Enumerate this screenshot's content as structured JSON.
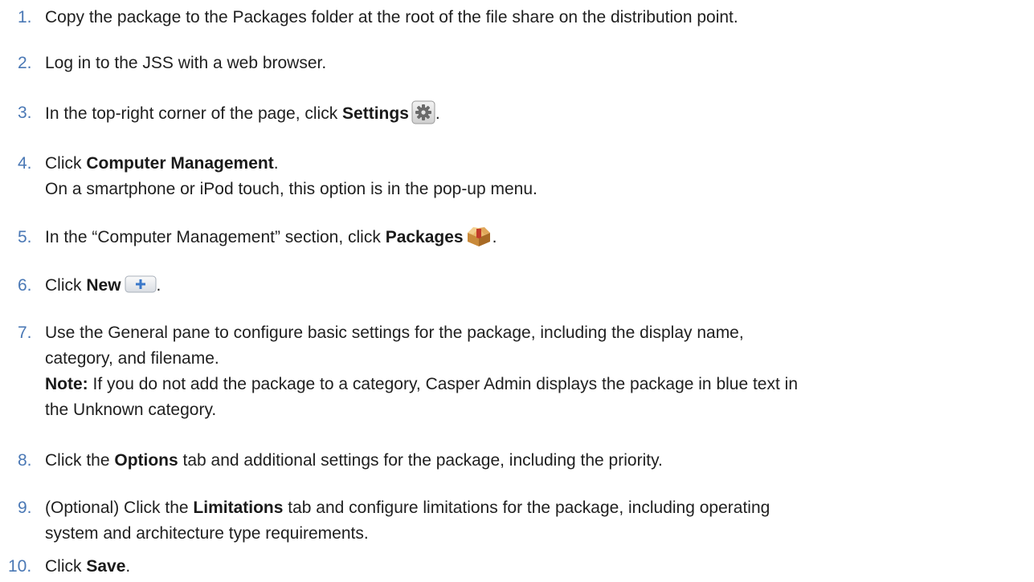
{
  "steps": [
    {
      "num": "1.",
      "lines": [
        "Copy the package to the Packages folder at the root of the file share on the distribution point."
      ]
    },
    {
      "num": "2.",
      "lines": [
        "Log in to the JSS with a web browser."
      ]
    },
    {
      "num": "3.",
      "pre": "In the top-right corner of the page, click ",
      "bold": "Settings",
      "post": "."
    },
    {
      "num": "4.",
      "pre": "Click ",
      "bold": "Computer Management",
      "post": ".",
      "line2": "On a smartphone or iPod touch, this option is in the pop-up menu."
    },
    {
      "num": "5.",
      "pre": "In the “Computer Management” section, click ",
      "bold": "Packages",
      "post": "."
    },
    {
      "num": "6.",
      "pre": "Click ",
      "bold": "New",
      "post": "."
    },
    {
      "num": "7.",
      "lines": [
        "Use the General pane to configure basic settings for the package, including the display name,",
        "category, and filename."
      ],
      "note_label": "Note:",
      "note_text": " If you do not add the package to a category, Casper Admin displays the package in blue text in",
      "note_line2": "the Unknown category."
    },
    {
      "num": "8.",
      "pre": "Click the ",
      "bold": "Options",
      "post": " tab and additional settings for the package, including the priority."
    },
    {
      "num": "9.",
      "pre": "(Optional) Click the ",
      "bold": "Limitations",
      "post": " tab and configure limitations for the package, including operating",
      "line2": "system and architecture type requirements."
    },
    {
      "num": "10.",
      "pre": "Click ",
      "bold": "Save",
      "post": "."
    }
  ],
  "icons": {
    "settings": "gear-icon",
    "packages": "package-box-icon",
    "new": "plus-icon"
  },
  "colors": {
    "step_number": "#4a78b5",
    "text": "#1f1f1f"
  }
}
